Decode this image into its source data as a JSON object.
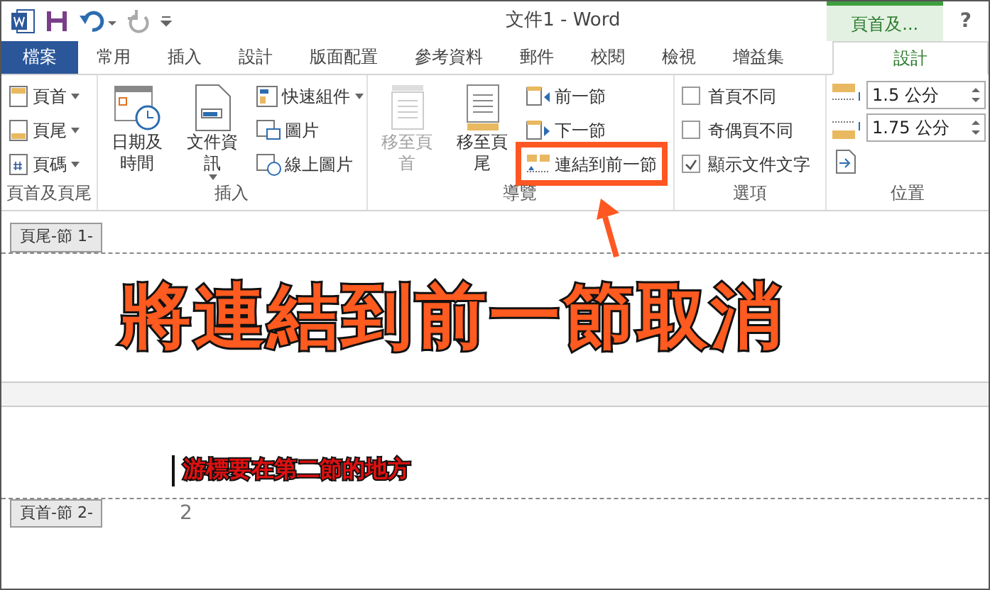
{
  "title_bar": {
    "title": "文件1 - Word",
    "context_tab": "頁首及...",
    "help": "?"
  },
  "tabs": [
    {
      "label": "檔案",
      "kind": "file",
      "selected": false
    },
    {
      "label": "常用",
      "kind": "tab",
      "selected": false
    },
    {
      "label": "插入",
      "kind": "tab",
      "selected": false
    },
    {
      "label": "設計",
      "kind": "tab",
      "selected": false
    },
    {
      "label": "版面配置",
      "kind": "tab",
      "selected": false
    },
    {
      "label": "參考資料",
      "kind": "tab",
      "selected": false
    },
    {
      "label": "郵件",
      "kind": "tab",
      "selected": false
    },
    {
      "label": "校閱",
      "kind": "tab",
      "selected": false
    },
    {
      "label": "檢視",
      "kind": "tab",
      "selected": false
    },
    {
      "label": "增益集",
      "kind": "tab",
      "selected": false
    },
    {
      "label": "設計",
      "kind": "context",
      "selected": true
    }
  ],
  "ribbon_groups": [
    {
      "label": "頁首及頁尾",
      "columns": [
        [
          {
            "kind": "small",
            "label": "頁首",
            "dropdown": true
          },
          {
            "kind": "small",
            "label": "頁尾",
            "dropdown": true
          },
          {
            "kind": "small",
            "label": "頁碼",
            "dropdown": true
          }
        ]
      ]
    },
    {
      "label": "插入",
      "columns": [
        [
          {
            "kind": "large",
            "label": "日期及時間",
            "dropdown": false
          }
        ],
        [
          {
            "kind": "large",
            "label": "文件資訊",
            "dropdown": true
          }
        ],
        [
          {
            "kind": "small",
            "label": "快速組件",
            "dropdown": true
          },
          {
            "kind": "small",
            "label": "圖片",
            "dropdown": false
          },
          {
            "kind": "small",
            "label": "線上圖片",
            "dropdown": false
          }
        ]
      ]
    },
    {
      "label": "導覽",
      "columns": [
        [
          {
            "kind": "large",
            "label": "移至頁首",
            "disabled": true
          }
        ],
        [
          {
            "kind": "large",
            "label": "移至頁尾",
            "disabled": false
          }
        ],
        [
          {
            "kind": "small",
            "label": "前一節",
            "highlighted": false
          },
          {
            "kind": "small",
            "label": "下一節",
            "highlighted": false
          },
          {
            "kind": "small",
            "label": "連結到前一節",
            "highlighted": true
          }
        ]
      ]
    },
    {
      "label": "選項",
      "columns": [
        [
          {
            "kind": "checkbox",
            "label": "首頁不同",
            "checked": false
          },
          {
            "kind": "checkbox",
            "label": "奇偶頁不同",
            "checked": false
          },
          {
            "kind": "checkbox",
            "label": "顯示文件文字",
            "checked": true
          }
        ]
      ]
    },
    {
      "label": "位置",
      "columns": [
        [
          {
            "kind": "spin",
            "value": "1.5 公分"
          },
          {
            "kind": "spin",
            "value": "1.75 公分"
          },
          {
            "kind": "icon"
          }
        ]
      ]
    }
  ],
  "document": {
    "footer_tag": "頁尾-節 1-",
    "annotation_title": "將連結到前一節取消",
    "annotation_note": "游標要在第二節的地方",
    "header_tag": "頁首-節 2-",
    "page_number": "2"
  }
}
